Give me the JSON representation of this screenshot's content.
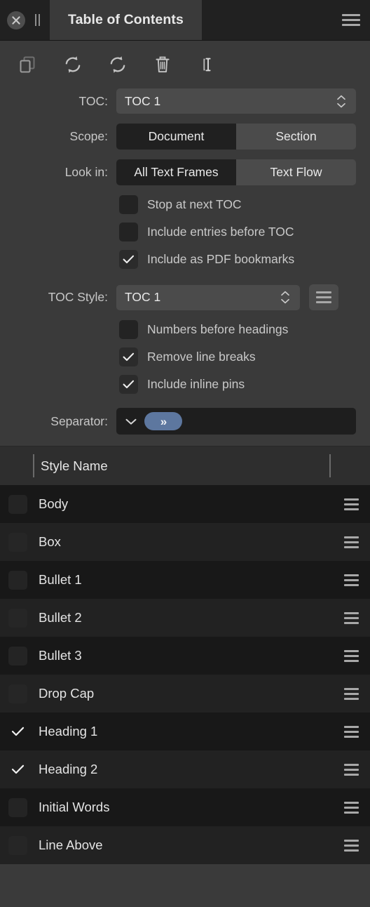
{
  "window": {
    "close_icon": "close-circle-icon",
    "grip_icon": "drag-grip-icon",
    "menu_icon": "hamburger-menu-icon",
    "tab_label": "Table of Contents"
  },
  "toolbar": {
    "items": [
      {
        "icon": "duplicate-pages-icon",
        "name": "duplicate-button"
      },
      {
        "icon": "refresh-ccw-icon",
        "name": "update-button"
      },
      {
        "icon": "refresh-all-icon",
        "name": "update-all-button"
      },
      {
        "icon": "trash-icon",
        "name": "delete-button"
      },
      {
        "icon": "text-cursor-icon",
        "name": "insert-text-button"
      }
    ]
  },
  "form": {
    "toc": {
      "label": "TOC:",
      "value": "TOC 1",
      "stepper_icon": "stepper-updown-icon"
    },
    "scope": {
      "label": "Scope:",
      "options": [
        "Document",
        "Section"
      ],
      "selected": "Document"
    },
    "look_in": {
      "label": "Look in:",
      "options": [
        "All Text Frames",
        "Text Flow"
      ],
      "selected": "All Text Frames"
    },
    "options_top": [
      {
        "label": "Stop at next TOC",
        "checked": false
      },
      {
        "label": "Include entries before TOC",
        "checked": false
      },
      {
        "label": "Include as PDF bookmarks",
        "checked": true
      }
    ],
    "toc_style": {
      "label": "TOC Style:",
      "value": "TOC 1",
      "stepper_icon": "stepper-updown-icon",
      "menu_icon": "hamburger-menu-icon"
    },
    "options_bottom": [
      {
        "label": "Numbers before headings",
        "checked": false
      },
      {
        "label": "Remove line breaks",
        "checked": true
      },
      {
        "label": "Include inline pins",
        "checked": true
      }
    ],
    "separator": {
      "label": "Separator:",
      "chevron_icon": "chevron-down-icon",
      "token_glyph": "»",
      "token_color": "#5d779f"
    }
  },
  "style_list": {
    "header": "Style Name",
    "rows": [
      {
        "name": "Body",
        "checked": false
      },
      {
        "name": "Box",
        "checked": false
      },
      {
        "name": "Bullet 1",
        "checked": false
      },
      {
        "name": "Bullet 2",
        "checked": false
      },
      {
        "name": "Bullet 3",
        "checked": false
      },
      {
        "name": "Drop Cap",
        "checked": false
      },
      {
        "name": "Heading 1",
        "checked": true
      },
      {
        "name": "Heading 2",
        "checked": true
      },
      {
        "name": "Initial Words",
        "checked": false
      },
      {
        "name": "Line Above",
        "checked": false
      }
    ],
    "row_grip_icon": "hamburger-grip-icon"
  }
}
